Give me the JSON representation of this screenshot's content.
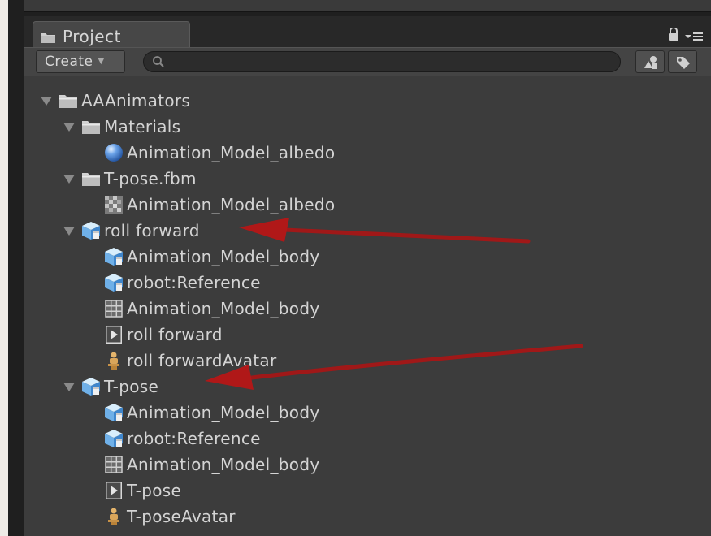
{
  "panel": {
    "tab_label": "Project",
    "create_label": "Create",
    "search_placeholder": ""
  },
  "tree": [
    {
      "label": "AAAnimators",
      "icon": "folder-icon"
    },
    {
      "label": "Materials",
      "icon": "folder-icon"
    },
    {
      "label": "Animation_Model_albedo",
      "icon": "material-sphere-icon"
    },
    {
      "label": "T-pose.fbm",
      "icon": "folder-icon"
    },
    {
      "label": "Animation_Model_albedo",
      "icon": "texture-icon"
    },
    {
      "label": "roll forward",
      "icon": "model-prefab-icon"
    },
    {
      "label": "Animation_Model_body",
      "icon": "model-prefab-icon"
    },
    {
      "label": "robot:Reference",
      "icon": "model-prefab-icon"
    },
    {
      "label": "Animation_Model_body",
      "icon": "mesh-grid-icon"
    },
    {
      "label": "roll forward",
      "icon": "animation-clip-icon"
    },
    {
      "label": "roll forwardAvatar",
      "icon": "avatar-icon"
    },
    {
      "label": "T-pose",
      "icon": "model-prefab-icon"
    },
    {
      "label": "Animation_Model_body",
      "icon": "model-prefab-icon"
    },
    {
      "label": "robot:Reference",
      "icon": "model-prefab-icon"
    },
    {
      "label": "Animation_Model_body",
      "icon": "mesh-grid-icon"
    },
    {
      "label": "T-pose",
      "icon": "animation-clip-icon"
    },
    {
      "label": "T-poseAvatar",
      "icon": "avatar-icon"
    }
  ],
  "colors": {
    "annotation_arrow": "#a01818",
    "panel_bg": "#3c3c3c",
    "text": "#d4d4d4"
  }
}
